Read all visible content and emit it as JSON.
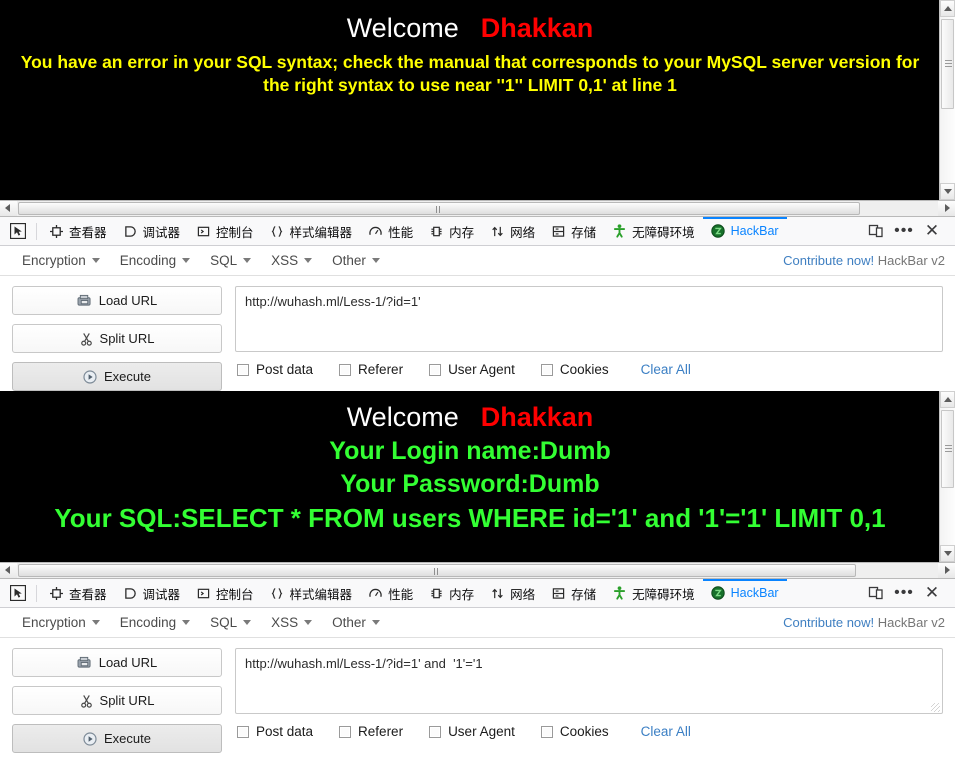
{
  "page_top": {
    "welcome_word": "Welcome",
    "welcome_name": "Dhakkan",
    "error_message": "You have an error in your SQL syntax; check the manual that corresponds to your MySQL server version for the right syntax to use near ''1'' LIMIT 0,1' at line 1",
    "bg_color": "#000000",
    "error_color": "#ffff00",
    "name_color": "#ff0000"
  },
  "page_bottom": {
    "welcome_word": "Welcome",
    "welcome_name": "Dhakkan",
    "login_line": "Your Login name:Dumb",
    "password_line": "Your Password:Dumb",
    "sql_line": "Your SQL:SELECT * FROM users WHERE id='1' and '1'='1' LIMIT 0,1",
    "success_color": "#33ff33"
  },
  "devtools": {
    "picker_icon": "element-picker-icon",
    "tabs": [
      {
        "label": "查看器",
        "icon": "inspector-icon",
        "active": false
      },
      {
        "label": "调试器",
        "icon": "debugger-icon",
        "active": false
      },
      {
        "label": "控制台",
        "icon": "console-icon",
        "active": false
      },
      {
        "label": "样式编辑器",
        "icon": "style-editor-icon",
        "active": false
      },
      {
        "label": "性能",
        "icon": "performance-icon",
        "active": false
      },
      {
        "label": "内存",
        "icon": "memory-icon",
        "active": false
      },
      {
        "label": "网络",
        "icon": "network-icon",
        "active": false
      },
      {
        "label": "存储",
        "icon": "storage-icon",
        "active": false
      },
      {
        "label": "无障碍环境",
        "icon": "accessibility-icon",
        "active": false
      },
      {
        "label": "HackBar",
        "icon": "hackbar-icon",
        "active": true
      }
    ],
    "right_buttons": [
      {
        "name": "responsive-design-mode-icon"
      },
      {
        "name": "meatball-menu-icon",
        "glyph": "•••"
      },
      {
        "name": "close-icon",
        "glyph": "✕"
      }
    ],
    "active_tab_color": "#0a84ff"
  },
  "hackbar": {
    "menus": [
      {
        "label": "Encryption"
      },
      {
        "label": "Encoding"
      },
      {
        "label": "SQL"
      },
      {
        "label": "XSS"
      },
      {
        "label": "Other"
      }
    ],
    "contribute_label": "Contribute now!",
    "version_label": "HackBar v2",
    "buttons": [
      {
        "label": "Load URL",
        "icon": "load-url-icon"
      },
      {
        "label": "Split URL",
        "icon": "split-url-icon"
      },
      {
        "label": "Execute",
        "icon": "execute-icon"
      }
    ],
    "url_top": "http://wuhash.ml/Less-1/?id=1'",
    "url_bottom": "http://wuhash.ml/Less-1/?id=1' and  '1'='1",
    "checkboxes": [
      {
        "label": "Post data",
        "checked": false
      },
      {
        "label": "Referer",
        "checked": false
      },
      {
        "label": "User Agent",
        "checked": false
      },
      {
        "label": "Cookies",
        "checked": false
      }
    ],
    "clear_all_label": "Clear All",
    "link_color": "#3b7fc4"
  }
}
